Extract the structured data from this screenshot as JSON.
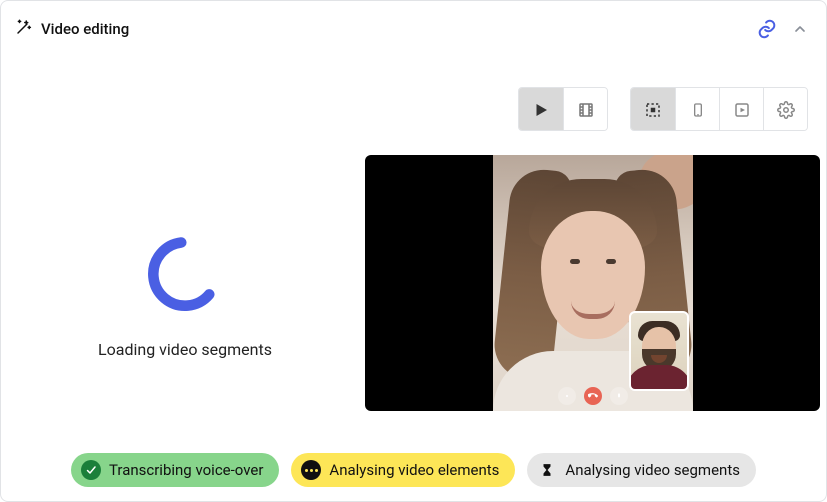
{
  "header": {
    "title": "Video editing",
    "icons": {
      "wand": "wand-icon",
      "link": "link-icon",
      "chevron": "chevron-up-icon"
    }
  },
  "toolbar": {
    "group1": [
      {
        "name": "play-button",
        "active": true
      },
      {
        "name": "film-button",
        "active": false
      }
    ],
    "group2": [
      {
        "name": "select-all-button",
        "active": true
      },
      {
        "name": "phone-frame-button",
        "active": false
      },
      {
        "name": "play-in-frame-button",
        "active": false
      },
      {
        "name": "settings-button",
        "active": false
      }
    ]
  },
  "loading": {
    "text": "Loading video segments"
  },
  "preview": {
    "call_buttons": [
      "mute",
      "end-call",
      "mic"
    ]
  },
  "status": {
    "chips": [
      {
        "state": "done",
        "label": "Transcribing voice-over",
        "color": "green"
      },
      {
        "state": "working",
        "label": "Analysing video elements",
        "color": "yellow"
      },
      {
        "state": "pending",
        "label": "Analysing video segments",
        "color": "grey"
      }
    ]
  }
}
